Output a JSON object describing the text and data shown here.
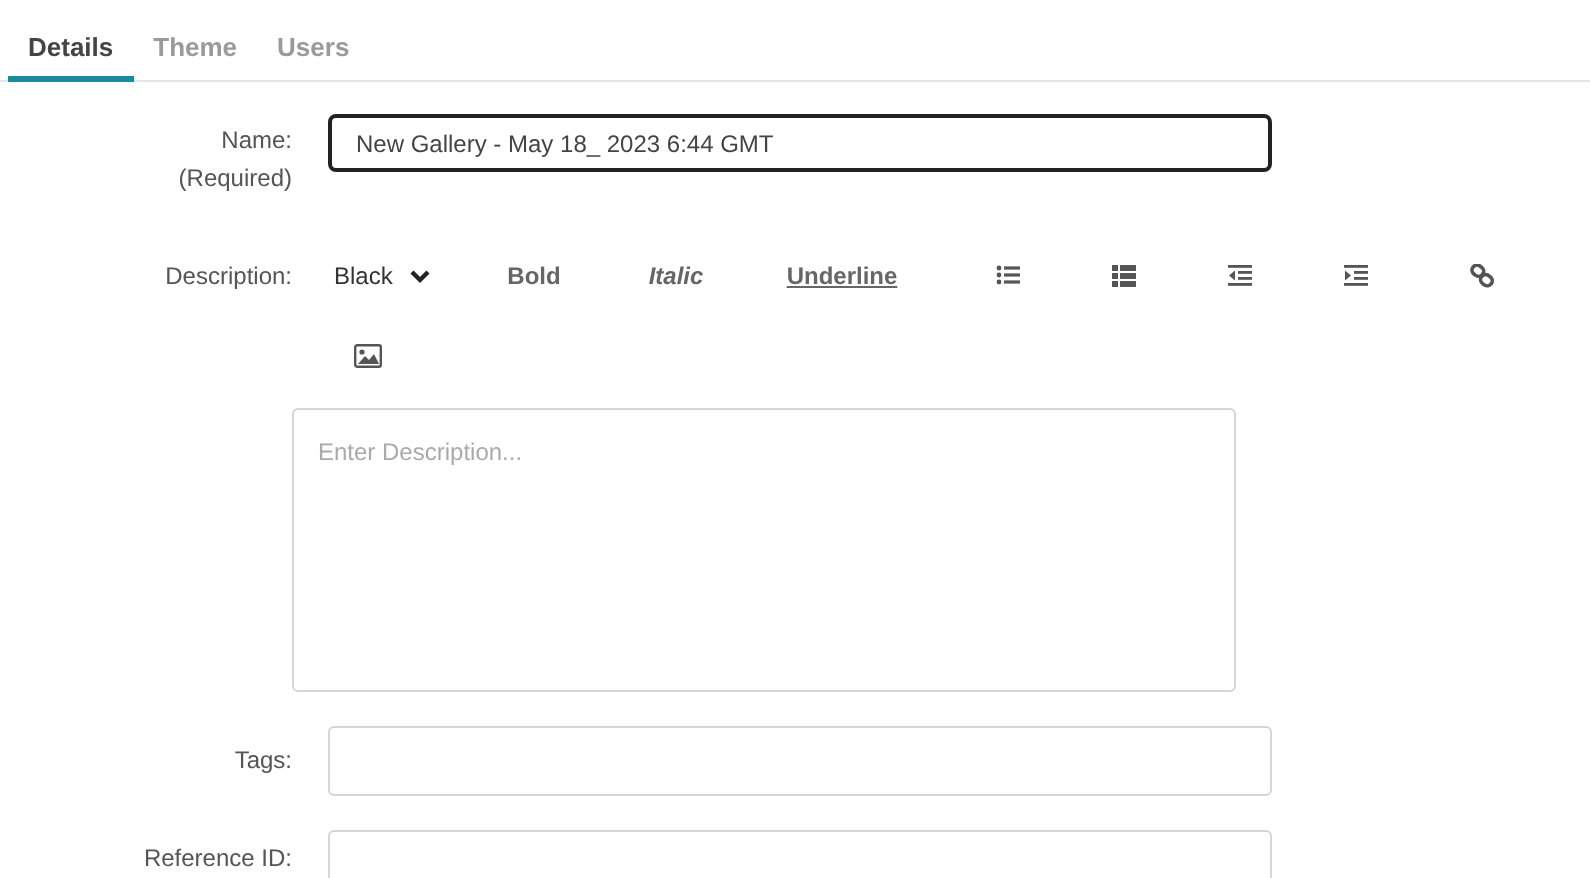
{
  "tabs": [
    {
      "label": "Details",
      "selected": true
    },
    {
      "label": "Theme",
      "selected": false
    },
    {
      "label": "Users",
      "selected": false
    }
  ],
  "name_field": {
    "label": "Name:",
    "note": "(Required)",
    "value": "New Gallery - May 18_ 2023 6:44 GMT"
  },
  "description": {
    "label": "Description:",
    "color_dropdown": "Black",
    "formats": [
      {
        "kind": "bold",
        "label": "Bold"
      },
      {
        "kind": "italic",
        "label": "Italic"
      },
      {
        "kind": "underline",
        "label": "Underline"
      }
    ],
    "placeholder": "Enter Description..."
  },
  "tags_field": {
    "label": "Tags:"
  },
  "reference_field": {
    "label": "Reference ID:"
  }
}
